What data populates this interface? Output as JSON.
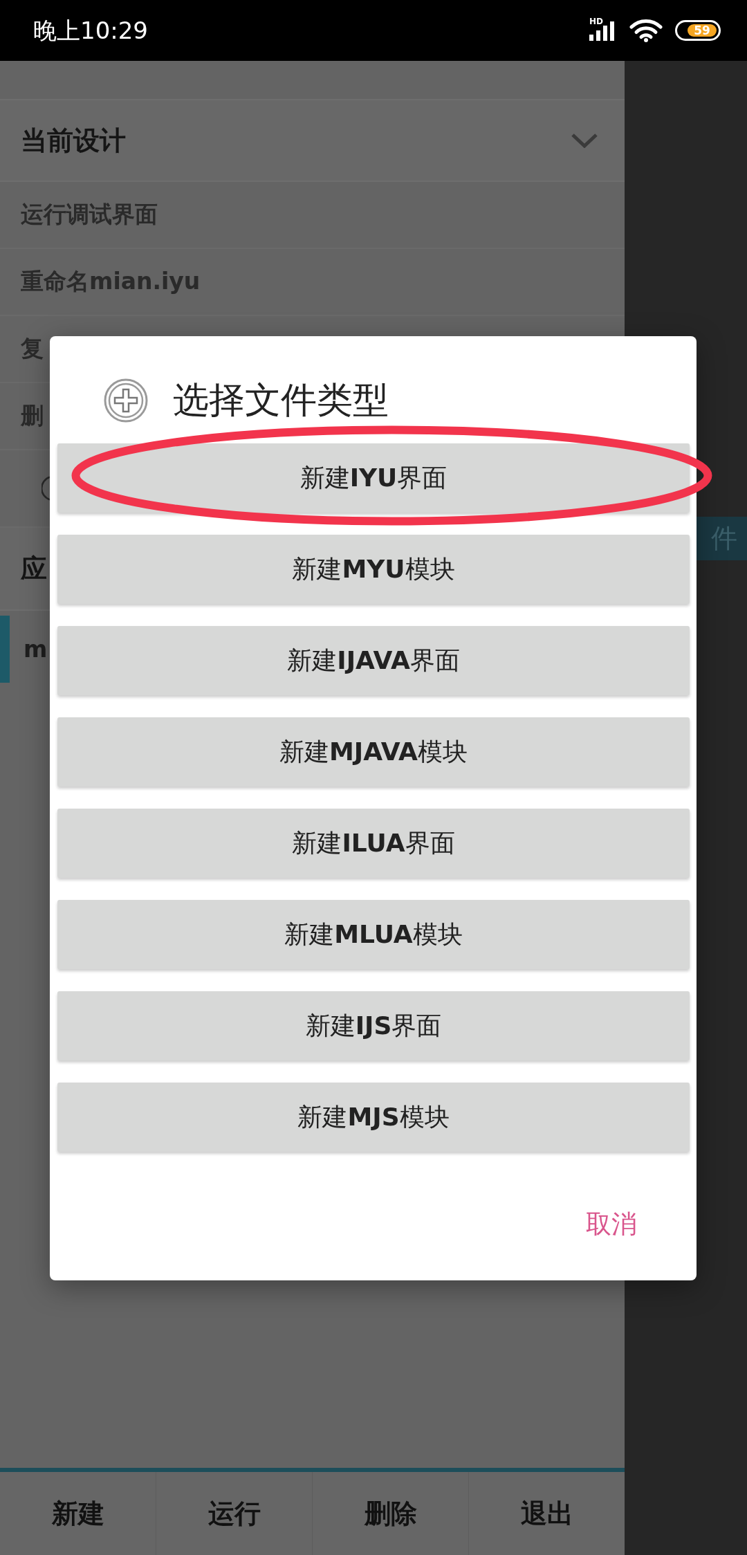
{
  "status_bar": {
    "time": "晚上10:29",
    "network_label": "HD",
    "battery_text": "59"
  },
  "side_panel": {
    "header": {
      "title": "当前设计"
    },
    "items": [
      {
        "kind": "text",
        "label": "运行调试界面"
      },
      {
        "kind": "text",
        "label": "重命名mian.iyu"
      },
      {
        "kind": "text",
        "label": "复"
      },
      {
        "kind": "text",
        "label": "删"
      },
      {
        "kind": "radio"
      }
    ],
    "section": {
      "title": "应"
    },
    "files": [
      {
        "label": "m",
        "selected": true
      }
    ]
  },
  "right_panel": {
    "tab_label": "件"
  },
  "dialog": {
    "title": "选择文件类型",
    "options": [
      {
        "label": "新建**IYU**界面",
        "highlighted": true
      },
      {
        "label": "新建**MYU**模块",
        "highlighted": false
      },
      {
        "label": "新建**IJAVA**界面",
        "highlighted": false
      },
      {
        "label": "新建**MJAVA**模块",
        "highlighted": false
      },
      {
        "label": "新建**ILUA**界面",
        "highlighted": false
      },
      {
        "label": "新建**MLUA**模块",
        "highlighted": false
      },
      {
        "label": "新建**IJS**界面",
        "highlighted": false
      },
      {
        "label": "新建**MJS**模块",
        "highlighted": false
      }
    ],
    "cancel": "取消"
  },
  "bottom_nav": [
    {
      "label": "新建"
    },
    {
      "label": "运行"
    },
    {
      "label": "删除"
    },
    {
      "label": "退出"
    }
  ]
}
